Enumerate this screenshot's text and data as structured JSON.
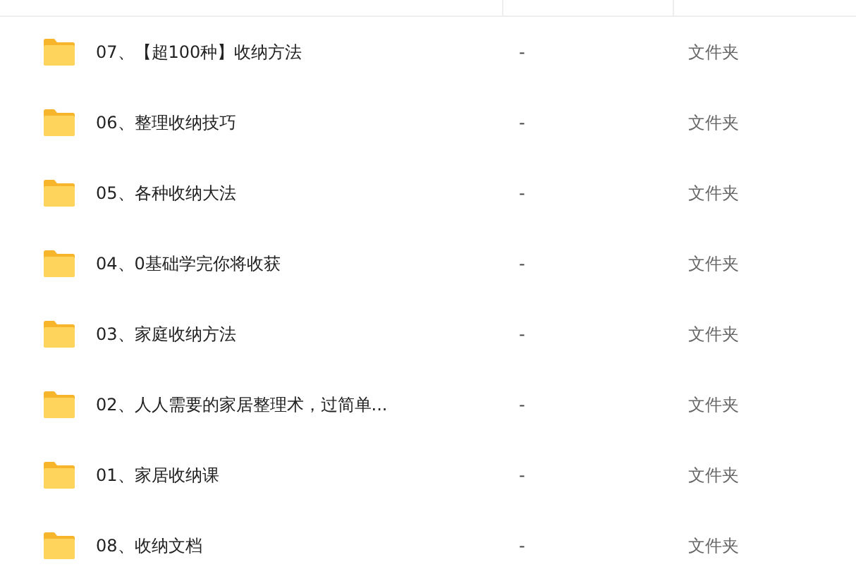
{
  "files": [
    {
      "name": "07、【超100种】收纳方法",
      "size": "-",
      "type": "文件夹"
    },
    {
      "name": "06、整理收纳技巧",
      "size": "-",
      "type": "文件夹"
    },
    {
      "name": "05、各种收纳大法",
      "size": "-",
      "type": "文件夹"
    },
    {
      "name": "04、0基础学完你将收获",
      "size": "-",
      "type": "文件夹"
    },
    {
      "name": "03、家庭收纳方法",
      "size": "-",
      "type": "文件夹"
    },
    {
      "name": "02、人人需要的家居整理术，过简单...",
      "size": "-",
      "type": "文件夹"
    },
    {
      "name": "01、家居收纳课",
      "size": "-",
      "type": "文件夹"
    },
    {
      "name": "08、收纳文档",
      "size": "-",
      "type": "文件夹"
    }
  ]
}
